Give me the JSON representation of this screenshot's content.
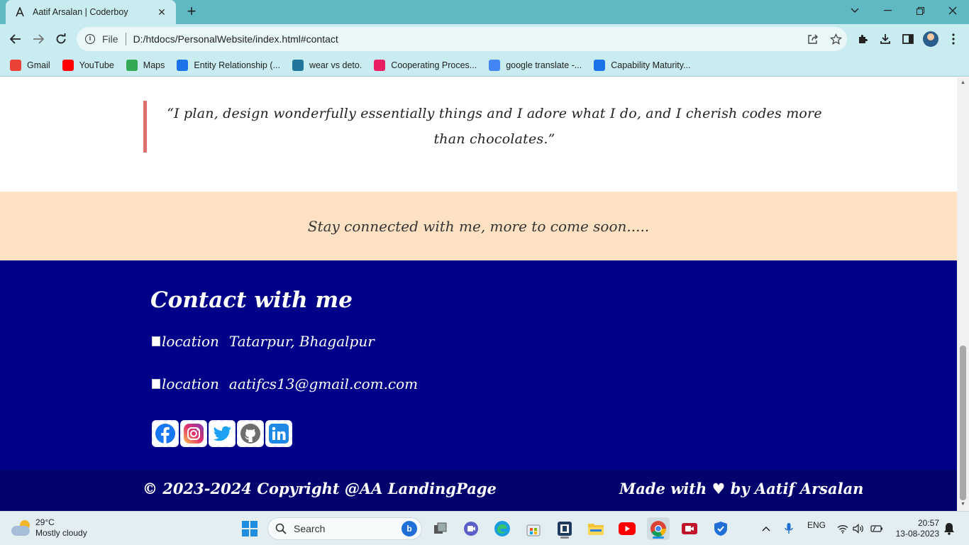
{
  "browser": {
    "tab_title": "Aatif Arsalan | Coderboy",
    "tab_close": "✕",
    "new_tab": "+",
    "address_scheme": "File",
    "address_url": "D:/htdocs/PersonalWebsite/index.html#contact",
    "bookmarks": [
      {
        "label": "Gmail",
        "icon": "gmail-icon",
        "color": "#ea4335"
      },
      {
        "label": "YouTube",
        "icon": "youtube-icon",
        "color": "#ff0000"
      },
      {
        "label": "Maps",
        "icon": "maps-icon",
        "color": "#34a853"
      },
      {
        "label": "Entity Relationship (...",
        "icon": "tutorial-site-icon",
        "color": "#1a73e8"
      },
      {
        "label": "wear vs deto.",
        "icon": "wordpress-icon",
        "color": "#21759b"
      },
      {
        "label": "Cooperating Proces...",
        "icon": "cube-icon",
        "color": "#e91e63"
      },
      {
        "label": "google translate -...",
        "icon": "google-icon",
        "color": "#4285f4"
      },
      {
        "label": "Capability Maturity...",
        "icon": "tutorial-site-icon",
        "color": "#1a73e8"
      }
    ]
  },
  "page": {
    "quote": "“I plan, design wonderfully essentially things and I adore what I do, and I cherish codes more than chocolates.”",
    "stay_connected": "Stay connected with me, more to come soon.....",
    "contact_title": "Contact with me",
    "location_alt": "location",
    "location_text": "Tatarpur, Bhagalpur",
    "email_alt": "location",
    "email_text": "aatifcs13@gmail.com.com",
    "socials": [
      "facebook-icon",
      "instagram-icon",
      "twitter-icon",
      "github-icon",
      "linkedin-icon"
    ],
    "copyright": "© 2023-2024 Copyright @AA LandingPage",
    "made_with": "Made with ♥ by Aatif Arsalan",
    "colors": {
      "footer_bg": "#000089",
      "copybar_bg": "#02036d",
      "stay_bg": "#ffe2c4",
      "quote_border": "#e07070"
    }
  },
  "taskbar": {
    "temperature": "29°C",
    "weather": "Mostly cloudy",
    "search_placeholder": "Search",
    "language": "ENG",
    "time": "20:57",
    "date": "13-08-2023"
  }
}
